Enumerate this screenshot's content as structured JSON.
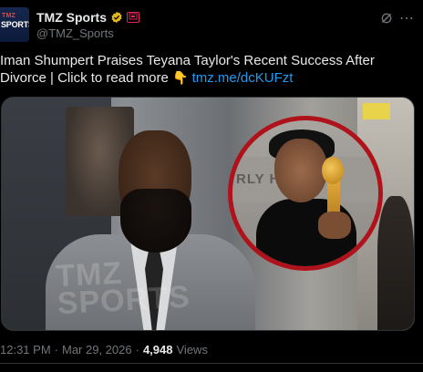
{
  "account": {
    "display_name": "TMZ Sports",
    "handle": "@TMZ_Sports",
    "avatar_text_top": "TMZ",
    "avatar_text_main": "SPORTS"
  },
  "tweet": {
    "text": "Iman Shumpert Praises Teyana Taylor's Recent Success After Divorce  |  Click to read more",
    "emoji": "👇",
    "link": "tmz.me/dcKUFzt"
  },
  "media": {
    "watermark": "TMZ SPORTS",
    "backdrop_text": "RLY HU"
  },
  "meta": {
    "time": "12:31 PM",
    "separator1": "·",
    "date": "Mar 29, 2026",
    "separator2": "·",
    "views_count": "4,948",
    "views_label": "Views"
  },
  "colors": {
    "background": "#000000",
    "text": "#e7e9ea",
    "secondary": "#71767b",
    "link": "#1d9bf0",
    "verified_gold": "#e2b719",
    "inset_border": "#b0121b"
  },
  "icons": {
    "verified": "verified-badge-icon",
    "affiliate": "affiliate-badge-icon",
    "grok": "grok-icon",
    "more": "more-icon"
  }
}
